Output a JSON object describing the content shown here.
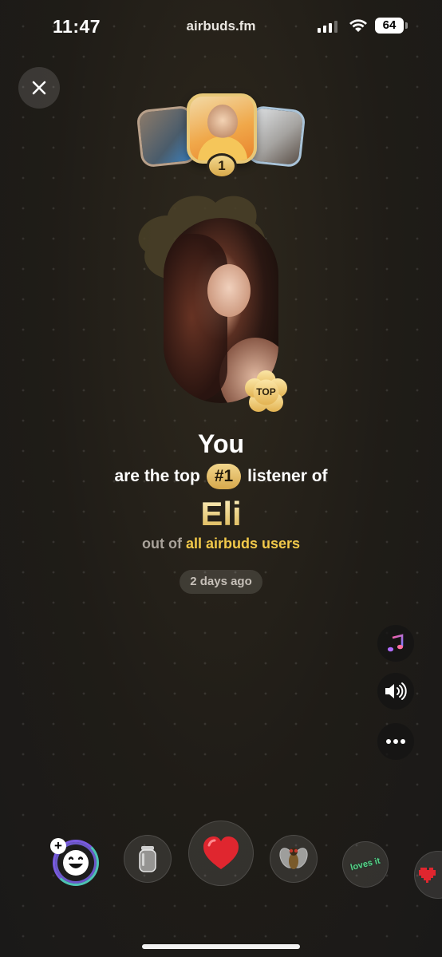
{
  "status_bar": {
    "time": "11:47",
    "url": "airbuds.fm",
    "battery": "64"
  },
  "ranking": {
    "badge": "1"
  },
  "artist_card": {
    "tag": "TOP"
  },
  "message": {
    "subject": "You",
    "prefix": "are the top",
    "rank": "#1",
    "suffix": "listener of",
    "artist": "Eli",
    "scope_prefix": "out of",
    "scope_highlight": "all airbuds users",
    "time_ago": "2 days ago"
  },
  "side_actions": [
    "music-note",
    "speaker",
    "more"
  ],
  "reactions": {
    "loves_label": "loves it"
  },
  "colors": {
    "accent_gold": "#f2c94a",
    "heart_red": "#e0262f",
    "loves_green": "#58d38a"
  }
}
